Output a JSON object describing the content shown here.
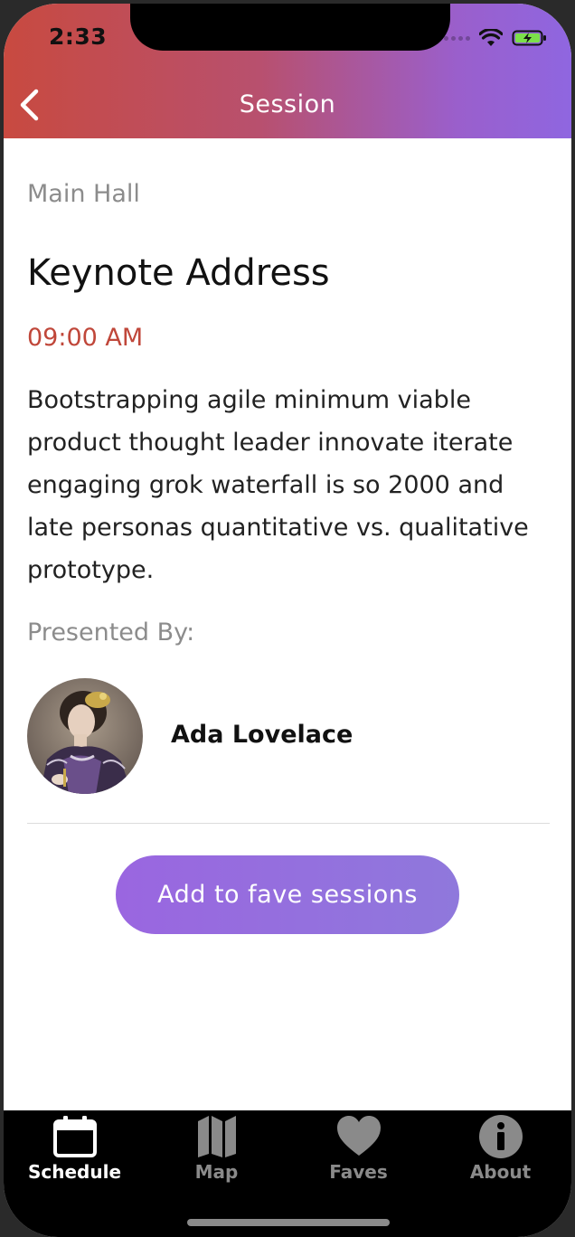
{
  "status_bar": {
    "time": "2:33"
  },
  "nav": {
    "title": "Session",
    "back_icon": "chevron-left-icon"
  },
  "session": {
    "location": "Main Hall",
    "title": "Keynote Address",
    "time": "09:00 AM",
    "description": "Bootstrapping agile minimum viable product thought leader innovate iterate engaging grok waterfall is so 2000 and late personas quantitative vs. qualitative prototype.",
    "presented_by_label": "Presented By:",
    "speaker": {
      "name": "Ada Lovelace"
    },
    "fave_button_label": "Add to fave sessions"
  },
  "tabs": [
    {
      "label": "Schedule",
      "icon": "calendar-icon",
      "active": true
    },
    {
      "label": "Map",
      "icon": "map-icon",
      "active": false
    },
    {
      "label": "Faves",
      "icon": "heart-icon",
      "active": false
    },
    {
      "label": "About",
      "icon": "info-icon",
      "active": false
    }
  ],
  "colors": {
    "header_gradient_start": "#c84a40",
    "header_gradient_end": "#8f66e0",
    "time_accent": "#c0473a",
    "button_gradient_start": "#9a66e0",
    "button_gradient_end": "#8f78dc",
    "tabbar_background": "#000000"
  }
}
